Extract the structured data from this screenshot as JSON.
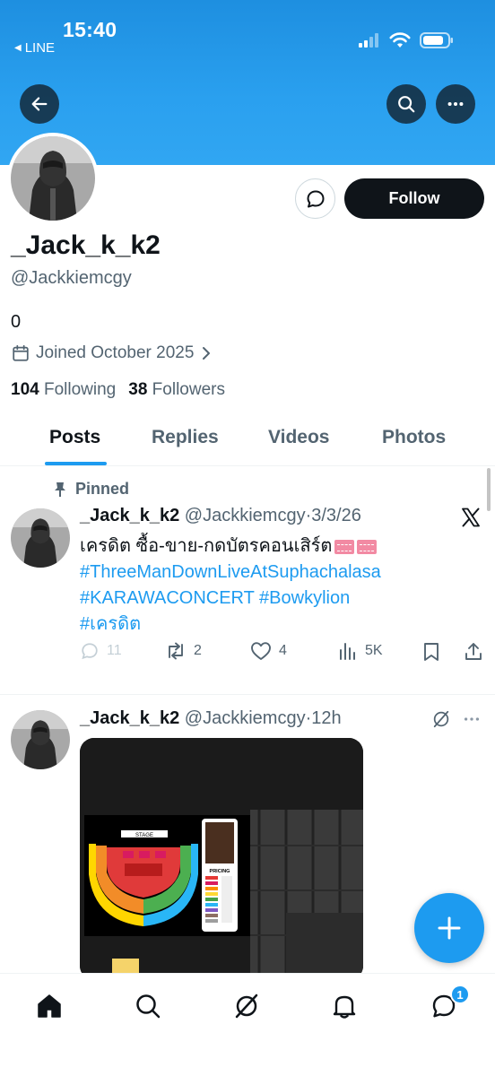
{
  "status_bar": {
    "time": "15:40",
    "back_app": "LINE"
  },
  "profile": {
    "display_name": "_Jack_k_k2",
    "handle": "@Jackkiemcgy",
    "bio": "0",
    "joined": "Joined October 2025",
    "following_count": "104",
    "following_label": "Following",
    "followers_count": "38",
    "followers_label": "Followers",
    "follow_label": "Follow"
  },
  "tabs": [
    {
      "label": "Posts",
      "active": true
    },
    {
      "label": "Replies",
      "active": false
    },
    {
      "label": "Videos",
      "active": false
    },
    {
      "label": "Photos",
      "active": false
    }
  ],
  "posts": [
    {
      "pinned_label": "Pinned",
      "name": "_Jack_k_k2",
      "handle": "@Jackkiemcgy",
      "sep": "·",
      "time": "3/3/26",
      "text": "เครดิต ซื้อ-ขาย-กดบัตรคอนเสิร์ต",
      "hashtags": [
        "#ThreeManDownLiveAtSuphachalasa",
        "#KARAWACONCERT",
        "#Bowkylion",
        "#เครดิต"
      ],
      "replies": "11",
      "reposts": "2",
      "likes": "4",
      "views": "5K"
    },
    {
      "name": "_Jack_k_k2",
      "handle": "@Jackkiemcgy",
      "sep": "·",
      "time": "12h"
    }
  ],
  "media_labels": {
    "stage": "STAGE",
    "pricing": "PRICING"
  },
  "bottom_nav": {
    "notifications_badge": "1"
  },
  "colors": {
    "accent": "#1d9bf0",
    "banner": "#2aa0ef",
    "text": "#0f1419",
    "muted": "#536471"
  }
}
